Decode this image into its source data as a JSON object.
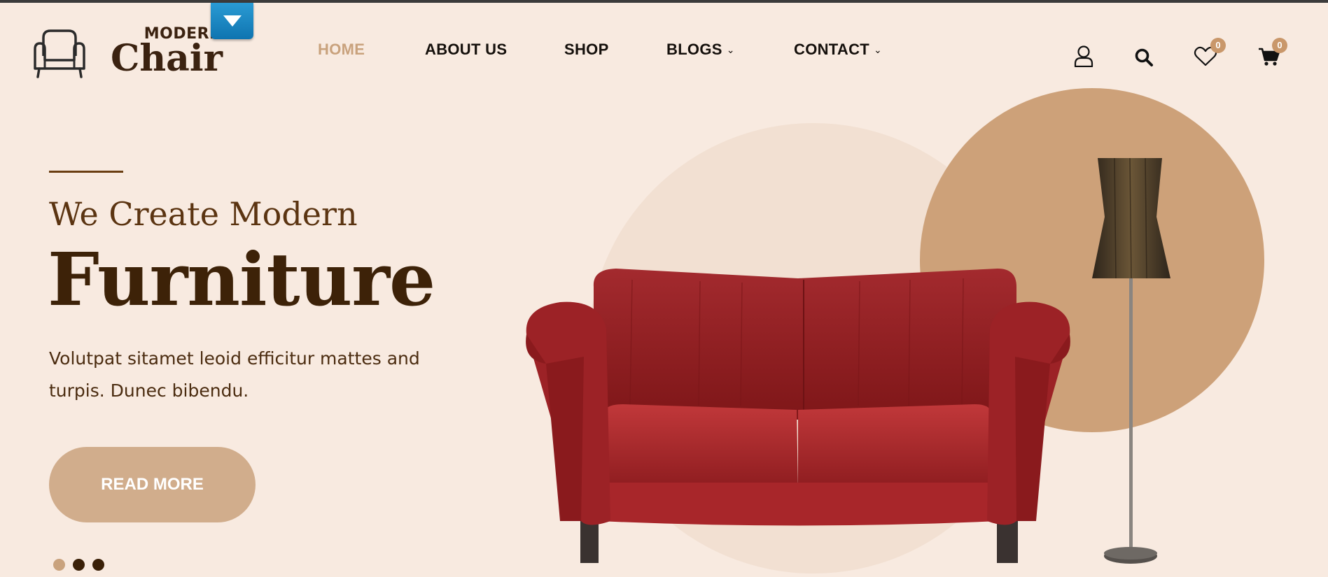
{
  "brand": {
    "logo_top": "MODERN",
    "logo_bottom": "Chair"
  },
  "nav": {
    "items": [
      {
        "label": "HOME",
        "active": true,
        "has_dropdown": false
      },
      {
        "label": "ABOUT US",
        "active": false,
        "has_dropdown": false
      },
      {
        "label": "SHOP",
        "active": false,
        "has_dropdown": false
      },
      {
        "label": "BLOGS",
        "active": false,
        "has_dropdown": true
      },
      {
        "label": "CONTACT",
        "active": false,
        "has_dropdown": true
      }
    ]
  },
  "header_icons": {
    "account": "user-icon",
    "search": "search-icon",
    "wishlist": "heart-icon",
    "cart": "cart-icon",
    "wishlist_count": "0",
    "cart_count": "0"
  },
  "hero": {
    "subtitle": "We Create Modern",
    "title": "Furniture",
    "description": "Volutpat sitamet leoid efficitur mattes and turpis. Dunec bibendu.",
    "button_label": "READ MORE",
    "slides": 3,
    "active_slide": 1
  },
  "colors": {
    "background": "#f8eae0",
    "accent": "#c9a27d",
    "dark_brown": "#3d2208",
    "circle_tan": "#cda179",
    "circle_light": "#f2e0d2",
    "badge": "#c9976a",
    "dropdown_tab": "#1a86c2"
  }
}
